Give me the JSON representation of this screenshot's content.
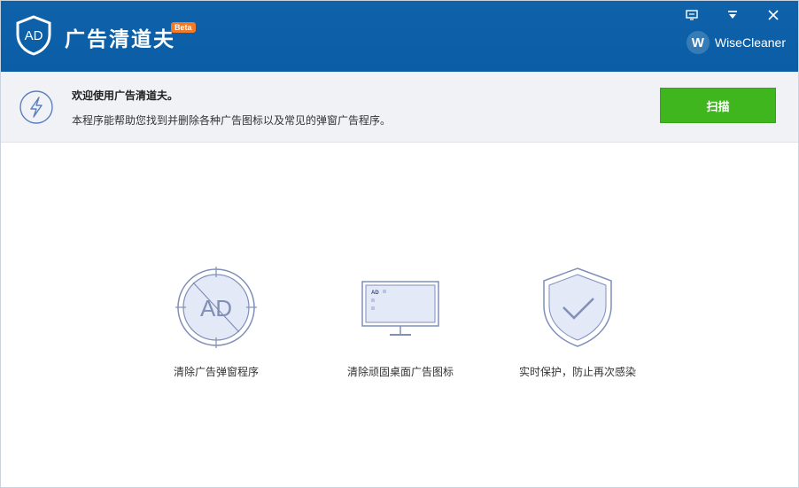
{
  "app": {
    "title": "广告清道夫",
    "beta": "Beta",
    "brand": "WiseCleaner",
    "brand_initial": "W",
    "logo_text": "AD"
  },
  "info": {
    "welcome": "欢迎使用广告清道夫。",
    "description": "本程序能帮助您找到并删除各种广告图标以及常见的弹窗广告程序。",
    "scan_label": "扫描"
  },
  "features": [
    {
      "label": "清除广告弹窗程序",
      "icon": "ad-blocked-icon",
      "icon_text": "AD"
    },
    {
      "label": "清除顽固桌面广告图标",
      "icon": "monitor-icon",
      "icon_text": "AD"
    },
    {
      "label": "实时保护，防止再次感染",
      "icon": "shield-check-icon"
    }
  ],
  "colors": {
    "titlebar": "#0b5ea6",
    "scan_button": "#3fb51e",
    "icon_stroke": "#7f8fb8",
    "icon_fill": "#e4e9f7",
    "beta_badge": "#f07a2a"
  }
}
